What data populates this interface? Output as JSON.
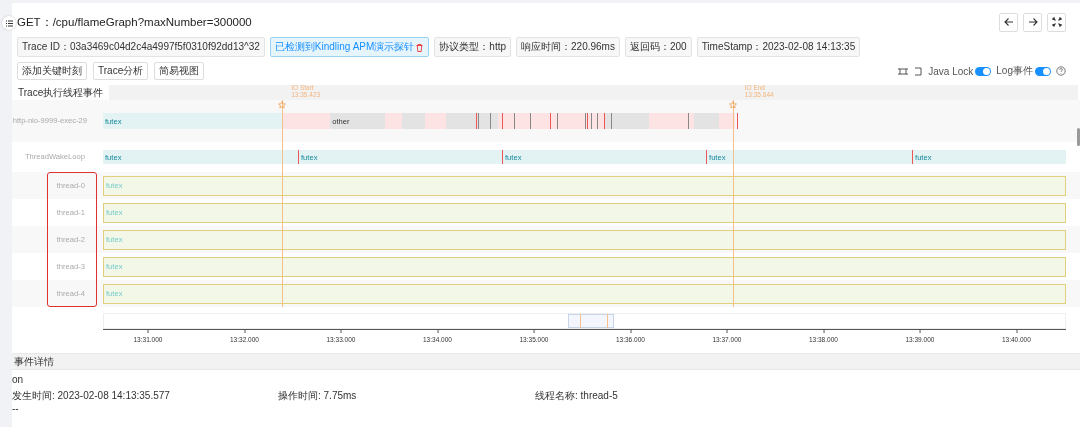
{
  "title": "GET：/cpu/flameGraph?maxNumber=300000",
  "chips": [
    {
      "text": "Trace ID：03a3469c04d2c4a4997f5f0310f92dd13^32",
      "kind": "plain"
    },
    {
      "text": "已检测到Kindling APM演示探针",
      "kind": "detected"
    },
    {
      "text": "协议类型：http",
      "kind": "plain"
    },
    {
      "text": "响应时间：220.96ms",
      "kind": "plain"
    },
    {
      "text": "返回码：200",
      "kind": "plain"
    },
    {
      "text": "TimeStamp：2023-02-08 14:13:35",
      "kind": "plain"
    }
  ],
  "actions": [
    "添加关键时刻",
    "Trace分析",
    "简易视图"
  ],
  "toggles": [
    {
      "label": "Java Lock",
      "on": true
    },
    {
      "label": "Log事件",
      "on": true
    }
  ],
  "timeline": {
    "heading": "Trace执行线程事件",
    "markers": [
      {
        "name": "IO Start",
        "time": "13:35.423"
      },
      {
        "name": "IO End",
        "time": "13:35.644"
      }
    ],
    "threads_highlighted": true,
    "rows": [
      {
        "name": "http-nio-9999-exec-29",
        "kind": "request",
        "segments": [
          "futex",
          "other"
        ]
      },
      {
        "name": "ThreadWakeLoop",
        "kind": "wake",
        "segments": [
          "futex",
          "futex",
          "futex",
          "futex",
          "futex"
        ]
      },
      {
        "name": "thread-0",
        "kind": "thread",
        "segments": [
          "futex"
        ]
      },
      {
        "name": "thread-1",
        "kind": "thread",
        "segments": [
          "futex"
        ]
      },
      {
        "name": "thread-2",
        "kind": "thread",
        "segments": [
          "futex"
        ]
      },
      {
        "name": "thread-3",
        "kind": "thread",
        "segments": [
          "futex"
        ]
      },
      {
        "name": "thread-4",
        "kind": "thread",
        "segments": [
          "futex"
        ]
      }
    ],
    "axis_ticks": [
      "13:31.000",
      "13:32.000",
      "13:33.000",
      "13:34.000",
      "13:35.000",
      "13:36.000",
      "13:37.000",
      "13:38.000",
      "13:39.000",
      "13:40.000"
    ]
  },
  "details": {
    "heading": "事件详情",
    "event": "on",
    "fields": [
      {
        "label": "发生时间:",
        "value": "2023-02-08 14:13:35.577"
      },
      {
        "label": "操作时间:",
        "value": "7.75ms"
      },
      {
        "label": "线程名称:",
        "value": "thread-5"
      }
    ],
    "note": "--"
  }
}
